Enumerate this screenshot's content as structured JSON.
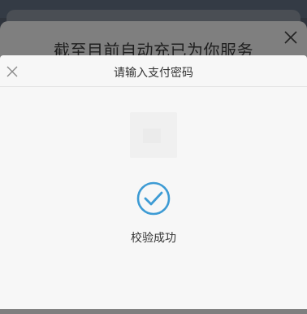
{
  "background_card": {
    "title": "截至目前自动充已为你服务",
    "close_icon": "close-icon"
  },
  "payment_sheet": {
    "title": "请输入支付密码",
    "close_icon": "close-icon",
    "status_icon": "check-circle-icon",
    "status_text": "校验成功"
  },
  "colors": {
    "accent": "#3d9bd4",
    "sheet_bg": "#f7f7f7",
    "overlay": "#7f7f7f",
    "text": "#333333"
  }
}
